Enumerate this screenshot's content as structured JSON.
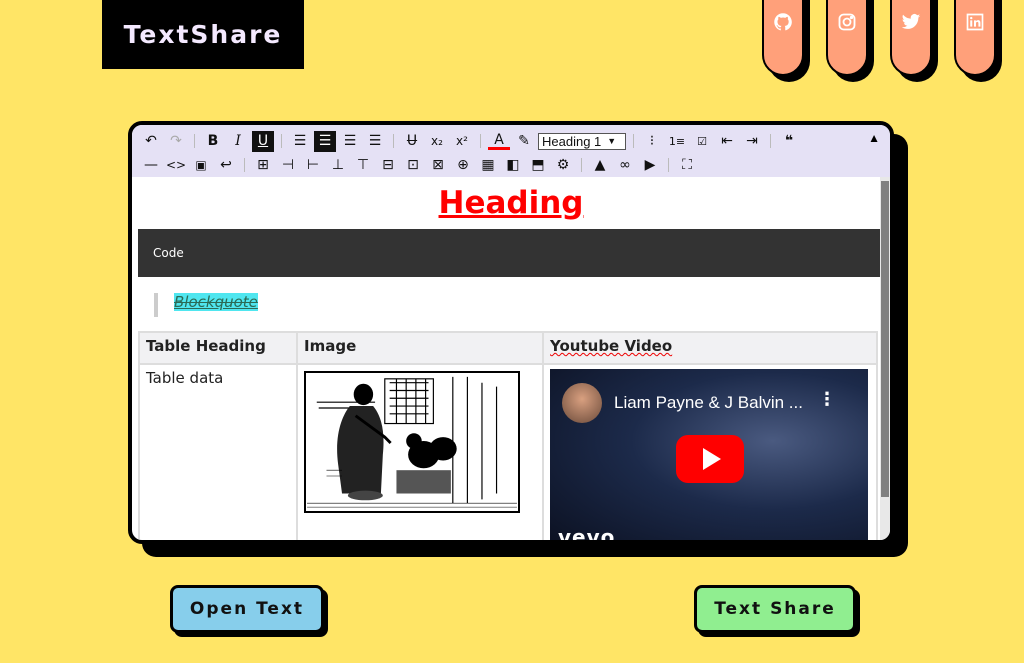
{
  "header": {
    "logo_text": "TextShare",
    "social": [
      {
        "icon": "github-icon"
      },
      {
        "icon": "instagram-icon"
      },
      {
        "icon": "twitter-icon"
      },
      {
        "icon": "linkedin-icon"
      }
    ]
  },
  "editor": {
    "toolbar": {
      "row1": [
        "undo-icon",
        "redo-icon",
        "bold-icon",
        "italic-icon",
        "underline-icon",
        "align-left-icon",
        "align-center-icon",
        "align-right-icon",
        "align-justify-icon",
        "strikethrough-icon",
        "subscript-icon",
        "superscript-icon",
        "font-color-icon",
        "highlight-icon",
        "block-type-select",
        "bulleted-list-icon",
        "numbered-list-icon",
        "checklist-icon",
        "outdent-icon",
        "indent-icon",
        "blockquote-icon",
        "collapse-toolbar-icon"
      ],
      "row2": [
        "horizontal-rule-icon",
        "inline-code-icon",
        "code-block-icon",
        "line-break-icon",
        "insert-table-icon",
        "insert-column-icon",
        "insert-column-after-icon",
        "insert-row-icon",
        "insert-row-after-icon",
        "delete-row-icon",
        "delete-column-icon",
        "delete-table-icon",
        "merge-cells-icon",
        "split-cells-icon",
        "toggle-header-column-icon",
        "toggle-header-row-icon",
        "cell-settings-icon",
        "insert-image-icon",
        "insert-link-icon",
        "insert-video-icon",
        "fullscreen-icon"
      ],
      "block_type_value": "Heading 1",
      "accent_color": "#ff0000"
    },
    "content": {
      "heading": "Heading",
      "code": "Code",
      "blockquote": "Blockquote",
      "table": {
        "headers": [
          "Table Heading",
          "Image",
          "Youtube Video"
        ],
        "rows": [
          [
            "Table data",
            "",
            ""
          ]
        ]
      },
      "video": {
        "title": "Liam Payne & J Balvin ...",
        "watermark": "vevo"
      }
    }
  },
  "actions": {
    "open_text": "Open Text",
    "text_share": "Text Share"
  },
  "colors": {
    "background": "#ffe566",
    "social_tab": "#ffa07a",
    "open_button": "#87ceeb",
    "share_button": "#90ee90",
    "toolbar": "#e5e1f5"
  }
}
